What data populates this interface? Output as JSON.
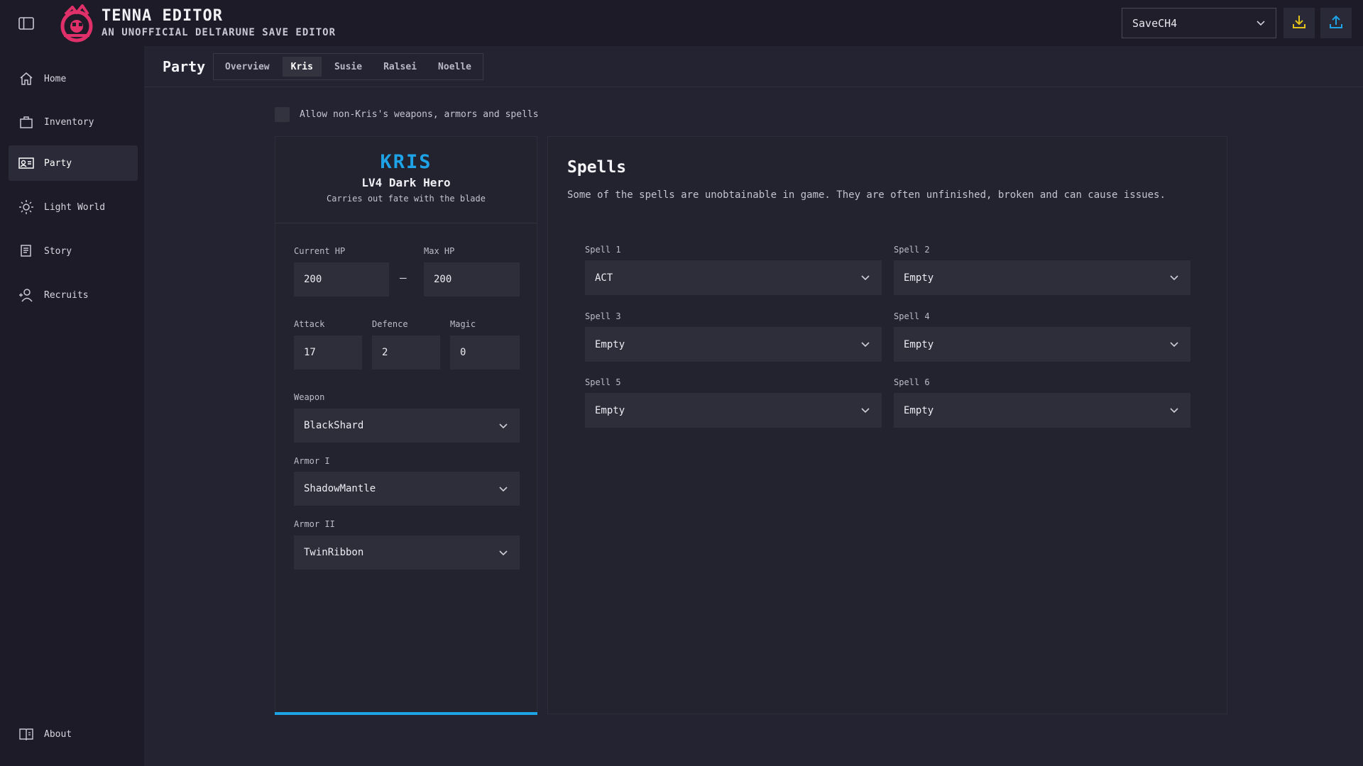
{
  "app": {
    "title": "TENNA EDITOR",
    "subtitle": "AN UNOFFICIAL DELTARUNE SAVE EDITOR",
    "accent": "#1ea3e6",
    "logo_color": "#e0306a"
  },
  "header": {
    "save_select": {
      "value": "SaveCH4",
      "icon": "chevron-down-icon"
    },
    "download_icon": "download-icon",
    "upload_icon": "upload-icon",
    "download_color": "#e3c21c",
    "upload_color": "#1ea3e6"
  },
  "sidebar": {
    "items": [
      {
        "label": "Home",
        "icon": "home-icon"
      },
      {
        "label": "Inventory",
        "icon": "briefcase-icon"
      },
      {
        "label": "Party",
        "icon": "id-card-icon",
        "active": true
      },
      {
        "label": "Light World",
        "icon": "sun-icon"
      },
      {
        "label": "Story",
        "icon": "notes-icon"
      },
      {
        "label": "Recruits",
        "icon": "user-add-icon"
      }
    ],
    "about": {
      "label": "About",
      "icon": "book-icon"
    }
  },
  "page": {
    "title": "Party",
    "tabs": [
      "Overview",
      "Kris",
      "Susie",
      "Ralsei",
      "Noelle"
    ],
    "active_tab": "Kris"
  },
  "allow": {
    "label": "Allow non-Kris's weapons, armors and spells",
    "checked": false
  },
  "character": {
    "name": "KRIS",
    "title": "LV4 Dark Hero",
    "description": "Carries out fate with the blade",
    "current_hp_label": "Current HP",
    "current_hp": "200",
    "hp_separator": "—",
    "max_hp_label": "Max HP",
    "max_hp": "200",
    "attack_label": "Attack",
    "attack": "17",
    "defence_label": "Defence",
    "defence": "2",
    "magic_label": "Magic",
    "magic": "0",
    "weapon_label": "Weapon",
    "weapon": "BlackShard",
    "armor1_label": "Armor I",
    "armor1": "ShadowMantle",
    "armor2_label": "Armor II",
    "armor2": "TwinRibbon"
  },
  "spells": {
    "title": "Spells",
    "note": "Some of the spells are unobtainable in game. They are often unfinished, broken and can cause issues.",
    "slots": [
      {
        "label": "Spell 1",
        "value": "ACT"
      },
      {
        "label": "Spell 2",
        "value": "Empty"
      },
      {
        "label": "Spell 3",
        "value": "Empty"
      },
      {
        "label": "Spell 4",
        "value": "Empty"
      },
      {
        "label": "Spell 5",
        "value": "Empty"
      },
      {
        "label": "Spell 6",
        "value": "Empty"
      }
    ]
  }
}
